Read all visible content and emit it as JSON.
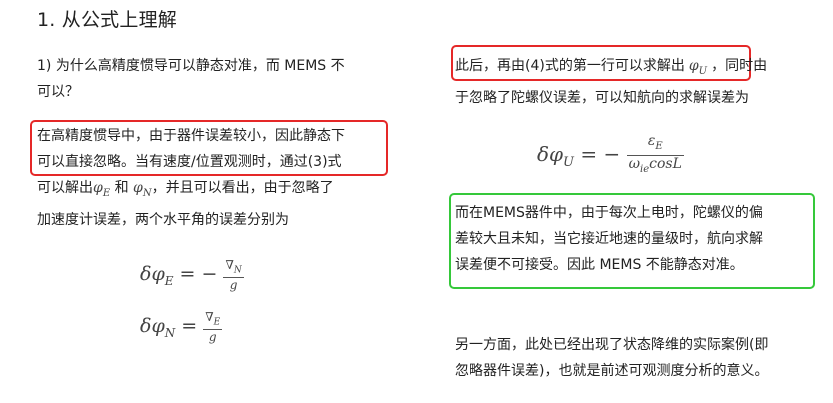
{
  "section_title": "1. 从公式上理解",
  "question": {
    "line1": "1) 为什么高精度惯导可以静态对准，而 MEMS 不",
    "line2": "可以？"
  },
  "left_paragraph": {
    "line1": "在高精度惯导中，由于器件误差较小，因此静态下",
    "line2": "可以直接忽略。当有速度/位置观测时，通过(3)式",
    "line3_pre": "可以解出",
    "phi_e": "φ",
    "phi_e_sub": "E",
    "line3_and": " 和 ",
    "phi_n": "φ",
    "phi_n_sub": "N",
    "line3_post": "，并且可以看出，由于忽略了",
    "line4": "加速度计误差，两个水平角的误差分别为"
  },
  "formula_left_1": {
    "lhs": "δφ",
    "lhs_sub": "E",
    "eq": " = −",
    "num": "∇",
    "num_sub": "N",
    "den": "g"
  },
  "formula_left_2": {
    "lhs": "δφ",
    "lhs_sub": "N",
    "eq": " = ",
    "num": "∇",
    "num_sub": "E",
    "den": "g"
  },
  "right_top": {
    "line1_pre": "此后，再由(4)式的第一行可以求解出",
    "phi_u": "φ",
    "phi_u_sub": "U",
    "line1_post": "，同时由",
    "line2": "于忽略了陀螺仪误差，可以知航向的求解误差为"
  },
  "formula_right": {
    "lhs": "δφ",
    "lhs_sub": "U",
    "eq": " = −",
    "num": "ε",
    "num_sub": "E",
    "den": "ω",
    "den_sub": "ie",
    "den_post": "cosL"
  },
  "right_mid": {
    "line1": "而在MEMS器件中，由于每次上电时，陀螺仪的偏",
    "line2": "差较大且未知，当它接近地速的量级时，航向求解",
    "line3": "误差便不可接受。因此 MEMS 不能静态对准。"
  },
  "right_bottom": {
    "line1": "另一方面，此处已经出现了状态降维的实际案例(即",
    "line2": "忽略器件误差)，也就是前述可观测度分析的意义。"
  },
  "colors": {
    "highlight_red": "#e52828",
    "highlight_green": "#35c83a",
    "text": "#222222"
  }
}
